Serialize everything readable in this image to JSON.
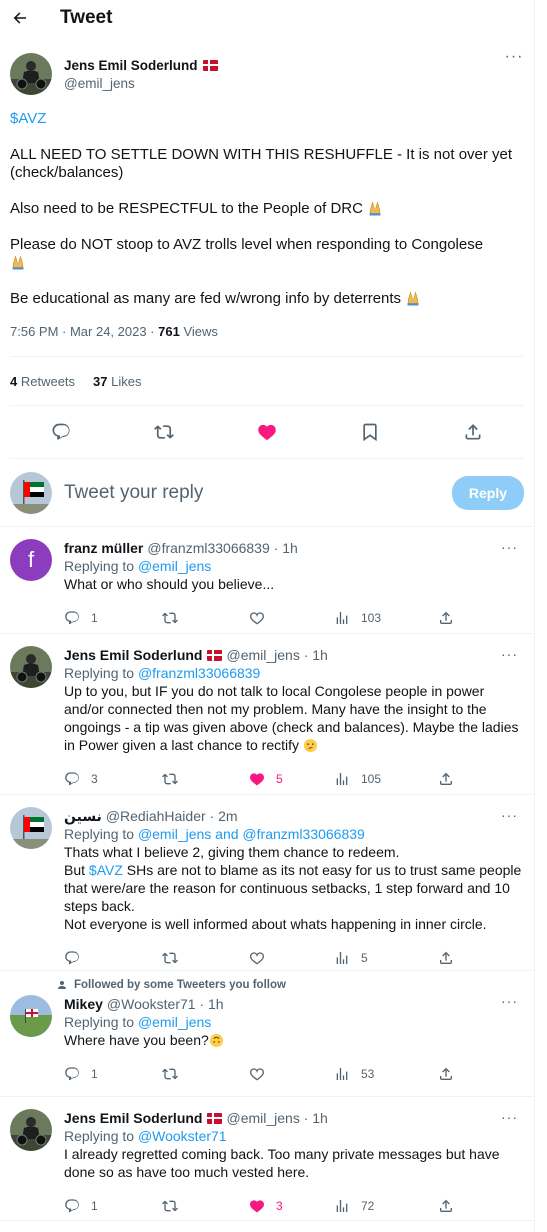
{
  "header": {
    "title": "Tweet"
  },
  "tweet": {
    "author_name": "Jens Emil Soderlund",
    "author_handle": "@emil_jens",
    "cashtag": "$AVZ",
    "para1": "ALL NEED TO SETTLE DOWN WITH THIS RESHUFFLE - It is not over yet (check/balances)",
    "para2": "Also need to be RESPECTFUL to the People of DRC",
    "para3": "Please do NOT stoop to AVZ trolls level when responding to Congolese",
    "para4": "Be educational as many are fed w/wrong info by deterrents",
    "time": "7:56 PM · Mar 24, 2023 · ",
    "views_count": "761",
    "views_label": " Views",
    "retweets_count": "4",
    "retweets_label": " Retweets",
    "likes_count": "37",
    "likes_label": " Likes"
  },
  "compose": {
    "placeholder": "Tweet your reply",
    "button": "Reply"
  },
  "replies": [
    {
      "name": "franz müller",
      "handle": "@franzml33066839 · 1h",
      "replying_label": "Replying to ",
      "replying_to": "@emil_jens",
      "text": "What or who should you believe...",
      "replies": "1",
      "likes": "",
      "views": "103"
    },
    {
      "name": "Jens Emil Soderlund",
      "handle": "@emil_jens · 1h",
      "replying_label": "Replying to ",
      "replying_to": "@franzml33066839",
      "text": "Up to you, but IF you do not talk to local Congolese people in power and/or connected then not my problem. Many have the insight to the ongoings - a tip was given above (check and balances). Maybe the ladies in Power given a last chance to rectify",
      "replies": "3",
      "likes": "5",
      "views": "105"
    },
    {
      "name": "نسين",
      "handle": "@RediahHaider · 2m",
      "replying_label": "Replying to ",
      "replying_to": "@emil_jens and @franzml33066839",
      "text_line1": "Thats what I believe 2, giving them chance to redeem.",
      "text_but": "But ",
      "text_cashtag": "$AVZ",
      "text_rest": " SHs are not to blame as its not easy for us to trust same people that were/are the reason for continuous setbacks, 1 step forward and 10 steps back.",
      "text_line3": "Not everyone is well informed about whats happening in inner circle.",
      "replies": "",
      "likes": "",
      "views": "5"
    },
    {
      "followed": "Followed by some Tweeters you follow",
      "name": "Mikey",
      "handle": "@Wookster71 · 1h",
      "replying_label": "Replying to ",
      "replying_to": "@emil_jens",
      "text": "Where have you been?",
      "replies": "1",
      "likes": "",
      "views": "53"
    },
    {
      "name": "Jens Emil Soderlund",
      "handle": "@emil_jens · 1h",
      "replying_label": "Replying to ",
      "replying_to": "@Wookster71",
      "text": "I already regretted coming back. Too many private messages but have done so as have too much vested here.",
      "replies": "1",
      "likes": "3",
      "views": "72"
    }
  ],
  "colors": {
    "accent": "#1d9bf0",
    "like": "#f91880",
    "muted": "#536471"
  }
}
